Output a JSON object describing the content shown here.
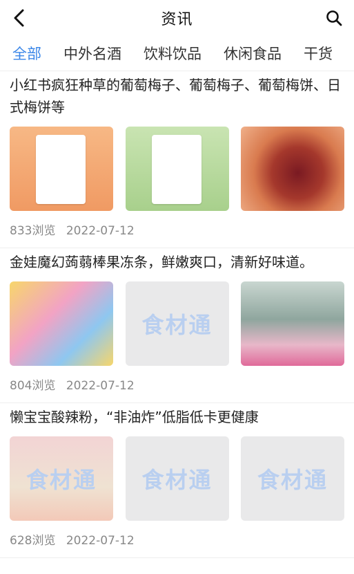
{
  "header": {
    "title": "资讯",
    "back_icon": "chevron-left-icon",
    "search_icon": "search-icon"
  },
  "tabs": [
    {
      "label": "全部",
      "active": true
    },
    {
      "label": "中外名酒"
    },
    {
      "label": "饮料饮品"
    },
    {
      "label": "休闲食品"
    },
    {
      "label": "干货"
    }
  ],
  "colors": {
    "accent": "#3a86e8",
    "meta": "#888888",
    "placeholder": "#e9e9ea"
  },
  "articles": [
    {
      "title": "小红书疯狂种草的葡萄梅子、葡萄梅子、葡萄梅饼、日式梅饼等",
      "views": "833浏览",
      "date": "2022-07-12",
      "watermark": "食材通"
    },
    {
      "title": "金娃魔幻蒟蒻棒果冻条，鲜嫩爽口，清新好味道。",
      "views": "804浏览",
      "date": "2022-07-12",
      "watermark": "食材通"
    },
    {
      "title": "懒宝宝酸辣粉，“非油炸”低脂低卡更健康",
      "views": "628浏览",
      "date": "2022-07-12",
      "watermark": "食材通"
    }
  ]
}
